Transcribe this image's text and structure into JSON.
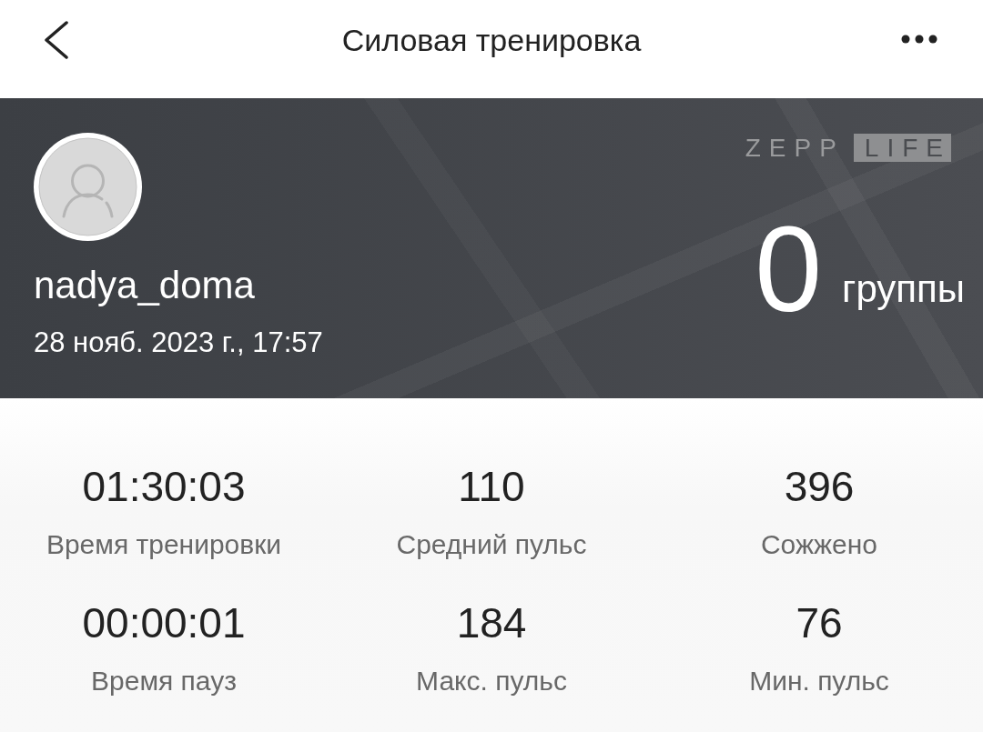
{
  "top_bar": {
    "title": "Силовая тренировка"
  },
  "profile": {
    "username": "nadya_doma",
    "date": "28 нояб. 2023 г., 17:57"
  },
  "logo": {
    "wordmark": "ZEPP",
    "tag": "LIFE"
  },
  "sets": {
    "count": "0",
    "unit": "группы"
  },
  "stats": [
    {
      "value": "01:30:03",
      "label": "Время тренировки"
    },
    {
      "value": "110",
      "label": "Средний пульс"
    },
    {
      "value": "396",
      "label": "Сожжено"
    },
    {
      "value": "00:00:01",
      "label": "Время пауз"
    },
    {
      "value": "184",
      "label": "Макс. пульс"
    },
    {
      "value": "76",
      "label": "Мин. пульс"
    }
  ]
}
